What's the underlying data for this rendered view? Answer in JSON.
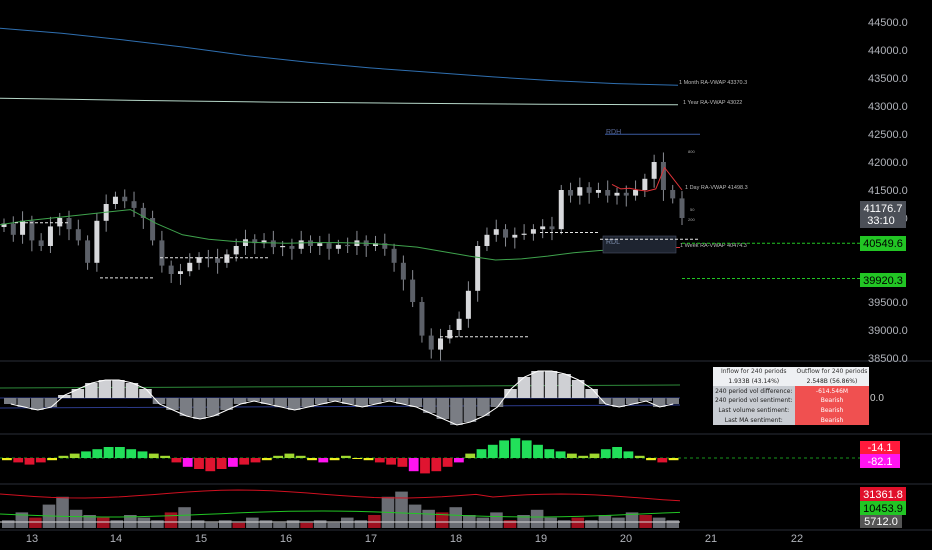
{
  "chart_data": {
    "type": "line",
    "x_labels": [
      "13",
      "14",
      "15",
      "16",
      "17",
      "18",
      "19",
      "20",
      "21",
      "22"
    ],
    "price_axis": [
      "44500.0",
      "44000.0",
      "43500.0",
      "43000.0",
      "42500.0",
      "42000.0",
      "41500.0",
      "41000.0",
      "39500.0",
      "39000.0",
      "38500.0"
    ],
    "price_range": [
      38500,
      44620
    ],
    "price_close": [
      40900,
      40700,
      40950,
      40600,
      40500,
      40850,
      41000,
      40800,
      40600,
      40200,
      40950,
      41250,
      41380,
      41300,
      41180,
      41000,
      40600,
      40150,
      40000,
      40050,
      40200,
      40300,
      40280,
      40200,
      40350,
      40500,
      40620,
      40550,
      40600,
      40480,
      40500,
      40450,
      40600,
      40500,
      40550,
      40450,
      40520,
      40500,
      40600,
      40500,
      40550,
      40450,
      40200,
      39900,
      39500,
      38900,
      38650,
      38850,
      39000,
      39200,
      39700,
      40500,
      40700,
      40800,
      40650,
      40700,
      40720,
      40800,
      40850,
      40800,
      41500,
      41400,
      41550,
      41450,
      41500,
      41400,
      41450,
      41400,
      41500,
      41700,
      42000,
      41500,
      41350,
      41000
    ],
    "current_price": {
      "value": "41176.7",
      "countdown": "33:10"
    },
    "price_tags": [
      {
        "value": "40549.6",
        "color": "#22c524"
      },
      {
        "value": "39920.3",
        "color": "#22c524"
      }
    ],
    "vwap_labels": {
      "month": "1 Month RA-VWAP 43370.3",
      "year": "1 Year RA-VWAP 43022",
      "day": "1 Day RA-VWAP 41498.3",
      "week": "1 Week RA-VWAP 40474.3"
    },
    "vwap_month": [
      44390,
      44300,
      44180,
      44050,
      43900,
      43780,
      43680,
      43600,
      43520,
      43450,
      43400,
      43370
    ],
    "vwap_year": [
      43140,
      43120,
      43100,
      43085,
      43070,
      43060,
      43050,
      43040,
      43033,
      43026,
      43022
    ],
    "vwap_week": [
      40880,
      40950,
      41000,
      41050,
      41100,
      41150,
      40900,
      40700,
      40620,
      40580,
      40560,
      40550,
      40560,
      40560,
      40550,
      40520,
      40480,
      40400,
      40320,
      40250,
      40270,
      40320,
      40380,
      40420,
      40440,
      40470,
      40474
    ],
    "vwap_day_values": [
      41600,
      41520,
      41530,
      41500,
      41480,
      41520,
      41900,
      41700,
      41500
    ],
    "rd_labels": {
      "high": "RDH",
      "low": "RDL"
    },
    "tiny_labels": [
      "800",
      "50",
      "200"
    ],
    "flow_zero": "0.0",
    "flow_histogram": [
      -2,
      -3,
      -4,
      -3,
      1,
      3,
      5,
      6,
      6,
      5,
      3,
      -2,
      -4,
      -6,
      -7,
      -6,
      -4,
      -2,
      -1,
      -2,
      -3,
      -4,
      -3,
      -2,
      -1,
      -2,
      -3,
      -2,
      -1,
      -2,
      -3,
      -5,
      -7,
      -9,
      -8,
      -6,
      -3,
      3,
      7,
      9,
      9,
      8,
      6,
      3,
      -2,
      -3,
      -2,
      -1,
      -3,
      -2
    ],
    "flow_table": {
      "inflow_header": "Inflow for 240 periods",
      "outflow_header": "Outflow for 240 periods",
      "inflow_value": "1.933B (43.14%)",
      "outflow_value": "2.548B (56.86%)",
      "vol_diff_label": "240 period vol difference:",
      "vol_diff_value": "-614.546M",
      "vol_sentiment_label": "240 period vol sentiment:",
      "vol_sentiment_value": "Bearish",
      "last_vol_label": "Last volume sentiment:",
      "last_vol_value": "Bearish",
      "last_ma_label": "Last MA sentiment:",
      "last_ma_value": "Bearish"
    },
    "osc_values": [
      -1,
      -2,
      -3,
      -2,
      -1,
      1,
      2,
      3,
      4,
      5,
      5,
      4,
      3,
      2,
      1,
      -2,
      -4,
      -5,
      -6,
      -5,
      -4,
      -3,
      -2,
      -1,
      1,
      2,
      1,
      -1,
      -2,
      -1,
      1,
      0,
      -1,
      -2,
      -3,
      -4,
      -6,
      -7,
      -6,
      -4,
      -2,
      2,
      4,
      6,
      8,
      9,
      8,
      6,
      4,
      3,
      2,
      1,
      2,
      4,
      5,
      3,
      1,
      -1,
      -2,
      -1
    ],
    "osc_tags": [
      {
        "value": "-14.1",
        "color": "#ff1a3c"
      },
      {
        "value": "-82.1",
        "color": "#ff14f0"
      }
    ],
    "vol_values": [
      3,
      6,
      4,
      9,
      12,
      7,
      5,
      4,
      3,
      5,
      4,
      3,
      6,
      8,
      3,
      2,
      3,
      2,
      4,
      3,
      2,
      3,
      2,
      3,
      2,
      4,
      3,
      5,
      12,
      14,
      9,
      7,
      6,
      8,
      5,
      4,
      6,
      3,
      5,
      7,
      4,
      3,
      4,
      3,
      5,
      4,
      6,
      5,
      4,
      3
    ],
    "vol_tags": [
      {
        "value": "31361.8",
        "color": "#e0102a"
      },
      {
        "value": "10453.9",
        "color": "#22c524"
      },
      {
        "value": "5712.0",
        "color": "#555555"
      }
    ]
  },
  "colors": {
    "background": "#000000",
    "month_vwap": "#2f6fb0",
    "year_vwap": "#b5d7c8",
    "week_vwap": "#3fa34d",
    "day_vwap": "#e0343a",
    "current_tag": "#4b4f57",
    "osc_green": "#22e05a",
    "osc_red": "#e01430",
    "osc_yellow": "#f0f020",
    "osc_magenta": "#ff14f0"
  }
}
